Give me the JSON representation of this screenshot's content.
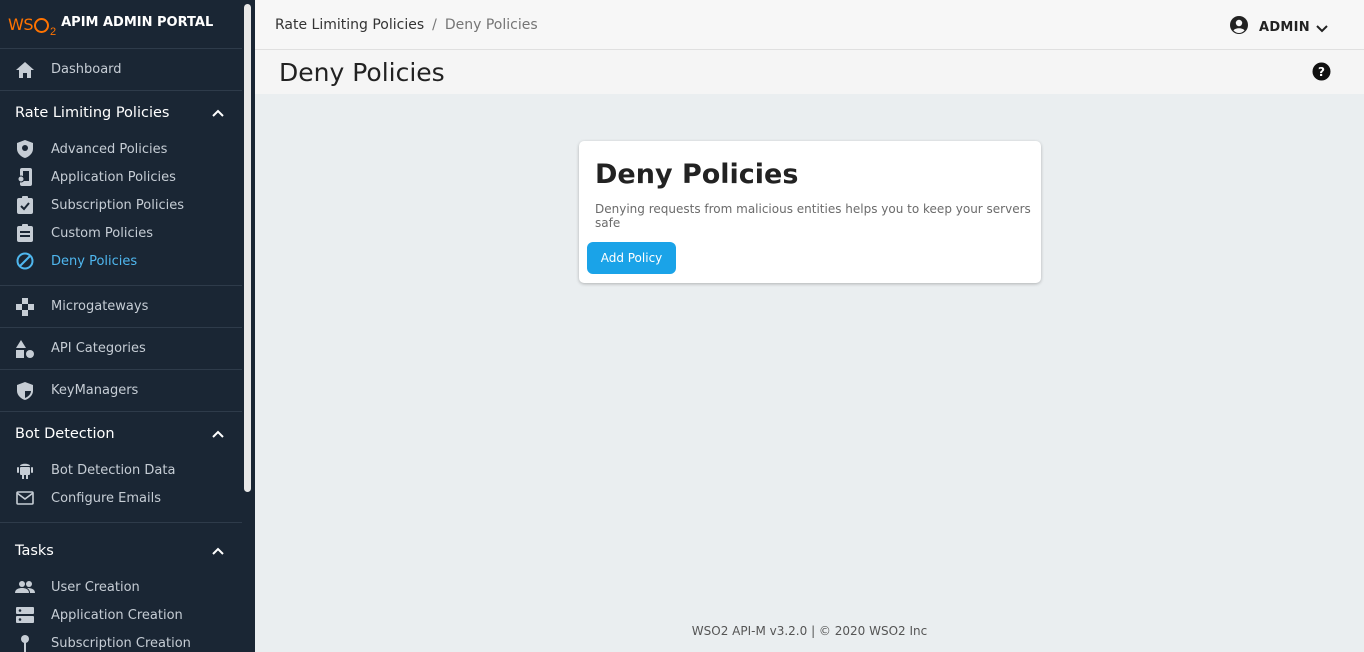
{
  "brand": {
    "logo": "WSO2",
    "title": "APIM ADMIN PORTAL",
    "accent": "#ff7300"
  },
  "sidebar": {
    "dashboard": {
      "label": "Dashboard",
      "icon": "home-icon"
    },
    "rate_limiting": {
      "title": "Rate Limiting Policies",
      "items": [
        {
          "label": "Advanced Policies",
          "icon": "advanced-policy-icon"
        },
        {
          "label": "Application Policies",
          "icon": "application-policy-icon"
        },
        {
          "label": "Subscription Policies",
          "icon": "subscription-policy-icon"
        },
        {
          "label": "Custom Policies",
          "icon": "custom-policy-icon"
        },
        {
          "label": "Deny Policies",
          "icon": "deny-icon",
          "active": true
        }
      ]
    },
    "microgateways": {
      "label": "Microgateways",
      "icon": "microgateway-icon"
    },
    "api_categories": {
      "label": "API Categories",
      "icon": "category-icon"
    },
    "key_managers": {
      "label": "KeyManagers",
      "icon": "shield-icon"
    },
    "bot_detection": {
      "title": "Bot Detection",
      "items": [
        {
          "label": "Bot Detection Data",
          "icon": "android-icon"
        },
        {
          "label": "Configure Emails",
          "icon": "email-icon"
        }
      ]
    },
    "tasks": {
      "title": "Tasks",
      "items": [
        {
          "label": "User Creation",
          "icon": "users-icon"
        },
        {
          "label": "Application Creation",
          "icon": "storage-icon"
        },
        {
          "label": "Subscription Creation",
          "icon": "pin-icon"
        }
      ]
    }
  },
  "topbar": {
    "breadcrumb": [
      "Rate Limiting Policies",
      "Deny Policies"
    ],
    "separator": "/",
    "user": "ADMIN"
  },
  "page": {
    "title": "Deny Policies"
  },
  "card": {
    "title": "Deny Policies",
    "description": "Denying requests from malicious entities helps you to keep your servers safe",
    "button": "Add Policy"
  },
  "footer": "WSO2 API-M v3.2.0 | © 2020 WSO2 Inc",
  "colors": {
    "sidebar_bg": "#1a2634",
    "active_link": "#4fb7ef",
    "primary_button": "#1aa3e8"
  }
}
